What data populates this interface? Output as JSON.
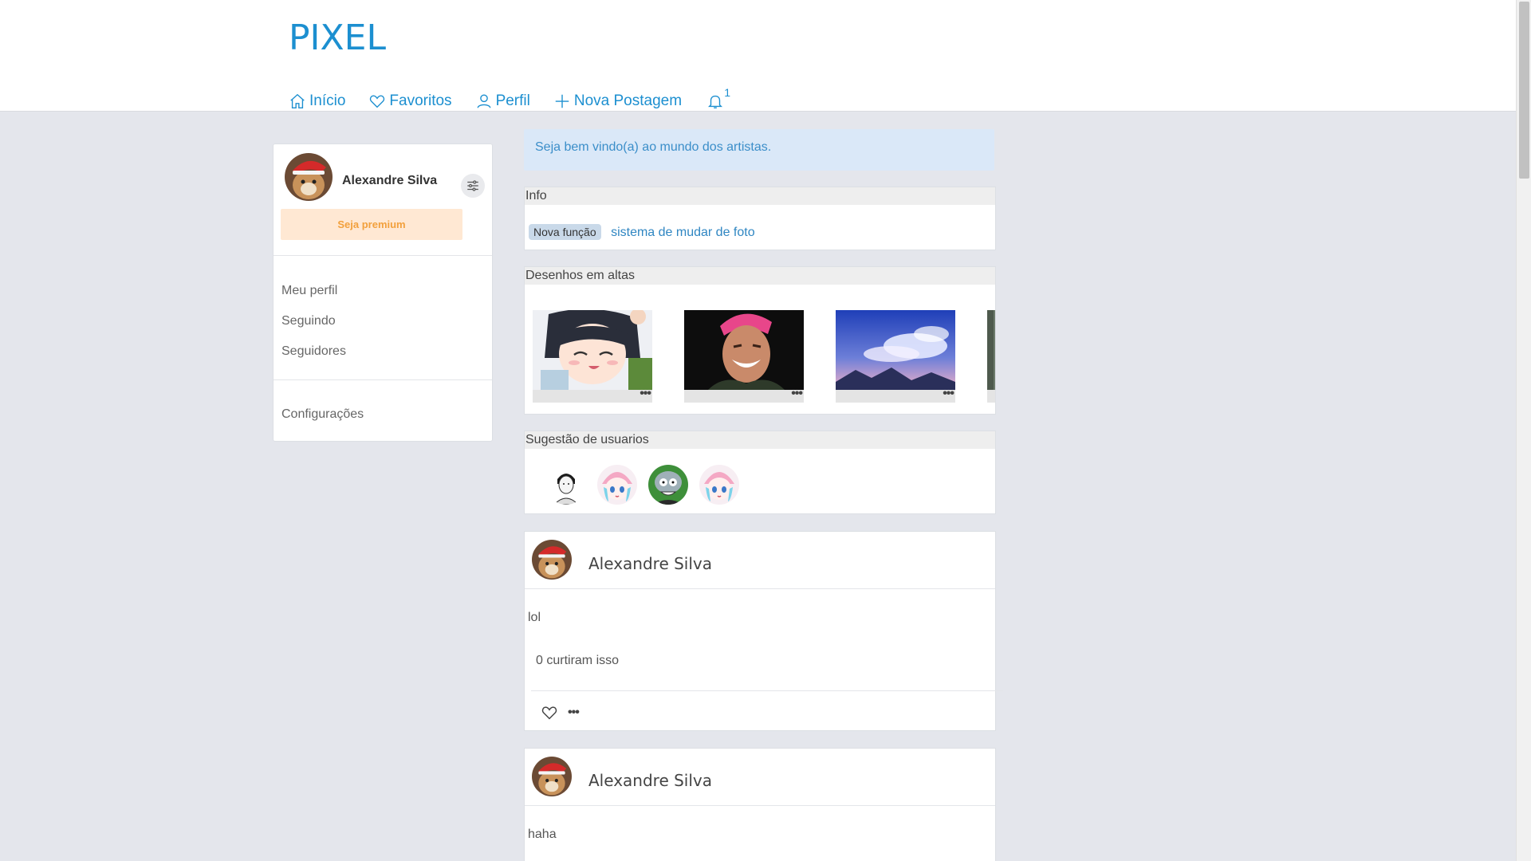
{
  "brand": "PIXEL",
  "nav": {
    "inicio": "Início",
    "favoritos": "Favoritos",
    "perfil": "Perfil",
    "nova_postagem": "Nova Postagem",
    "notifications_count": "1"
  },
  "sidebar": {
    "user_name": "Alexandre Silva",
    "premium_label": "Seja premium",
    "links": [
      "Meu perfil",
      "Seguindo",
      "Seguidores"
    ],
    "settings_label": "Configurações"
  },
  "welcome": "Seja bem vindo(a) ao mundo dos artistas.",
  "info": {
    "title": "Info",
    "badge": "Nova função",
    "text": "sistema de mudar de foto"
  },
  "trending": {
    "title": "Desenhos em altas",
    "more_label": "•••"
  },
  "suggestions": {
    "title": "Sugestão de usuarios"
  },
  "posts": [
    {
      "author": "Alexandre Silva",
      "text": "lol",
      "likes": "0 curtiram isso",
      "more_label": "•••"
    },
    {
      "author": "Alexandre Silva",
      "text": "haha"
    }
  ],
  "colors": {
    "accent": "#1c8fd0",
    "background": "#e4e6ec",
    "premium_bg": "#ffe8d3",
    "premium_text": "#f2a03c",
    "welcome_bg": "#dae8f8"
  }
}
